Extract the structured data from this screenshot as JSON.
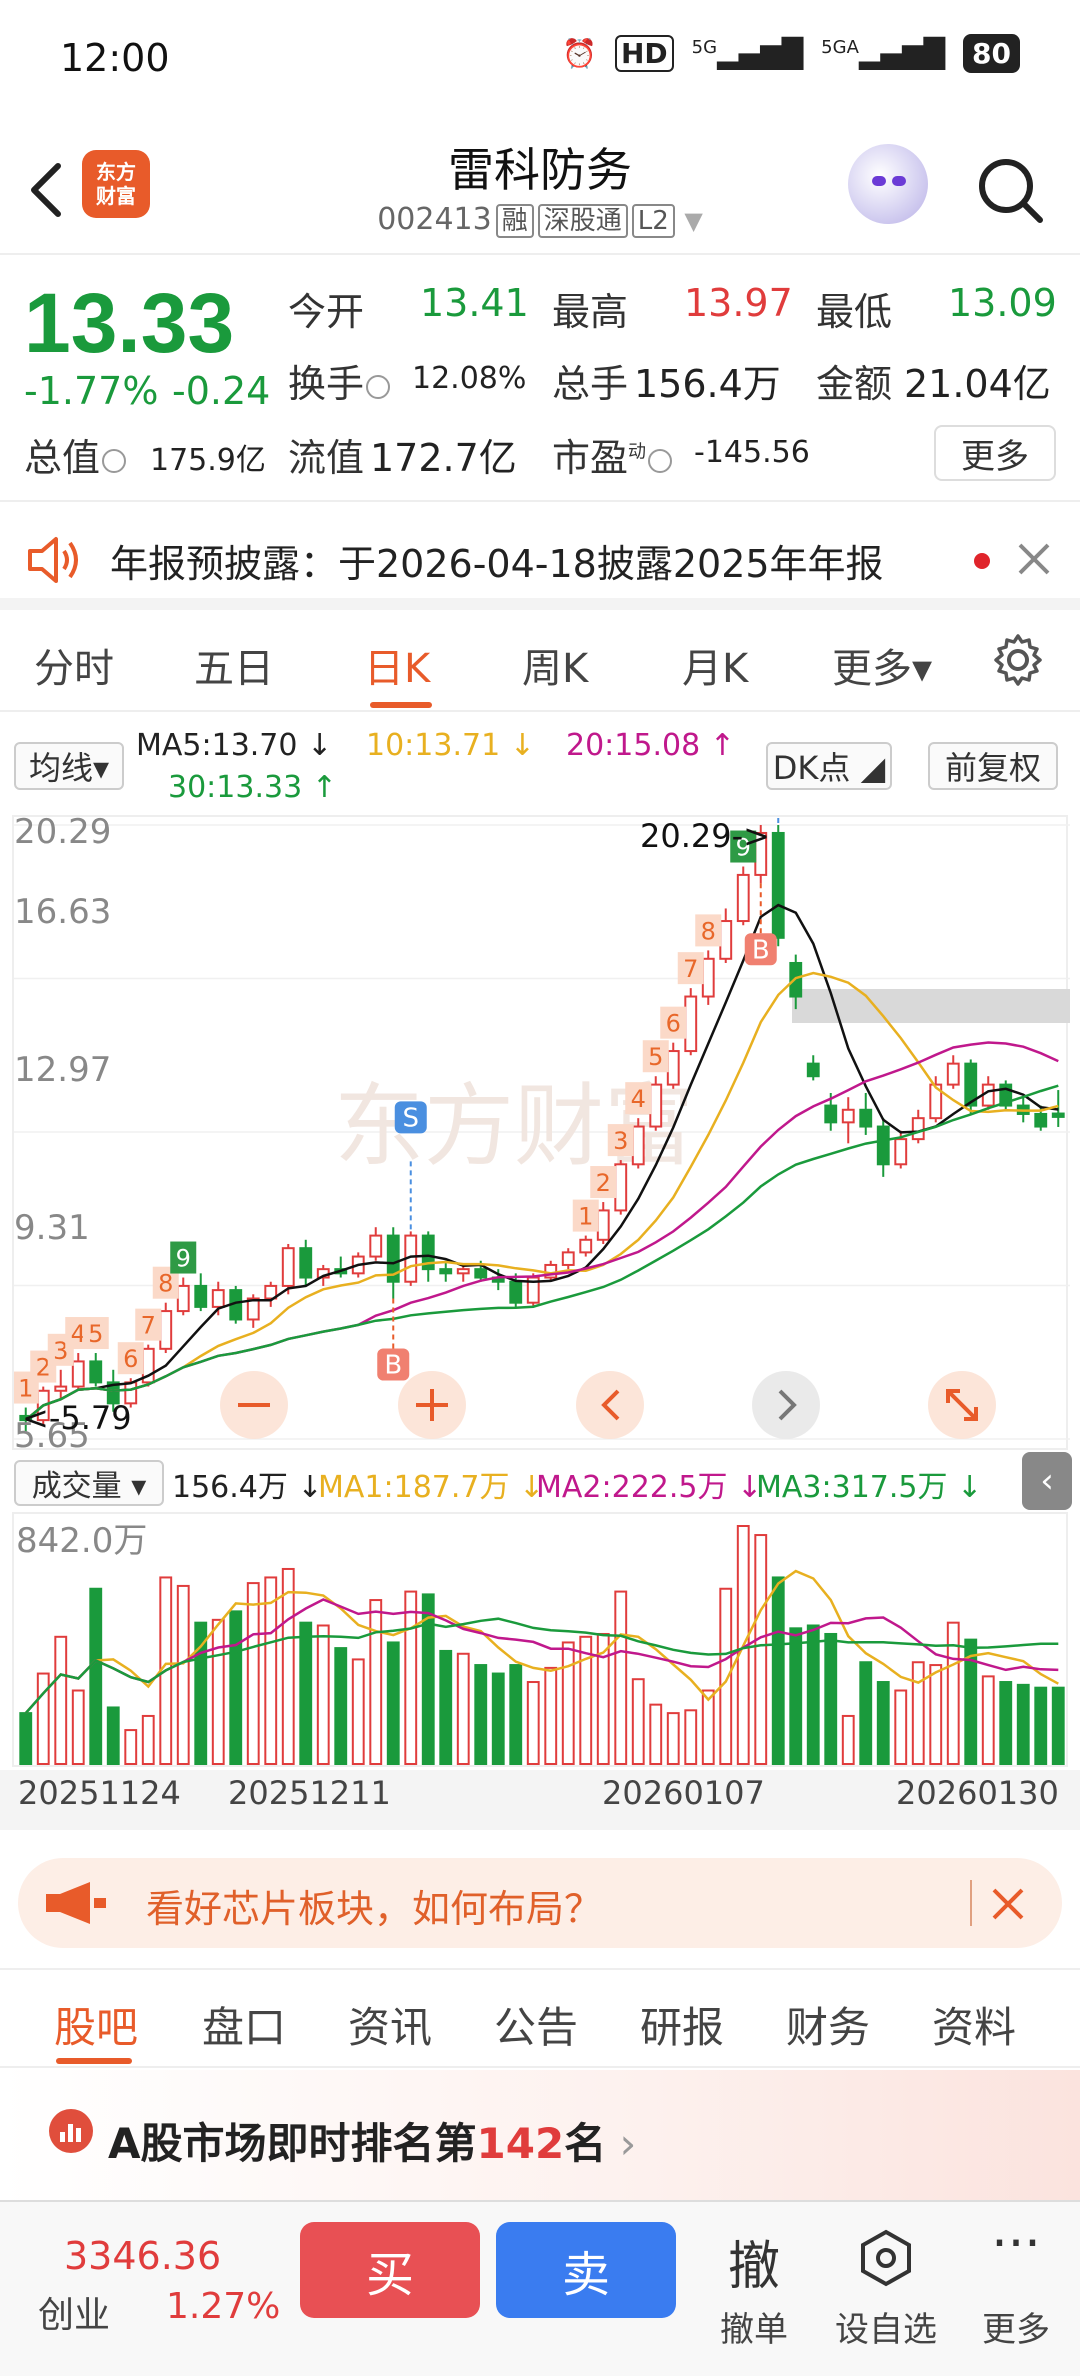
{
  "status": {
    "time": "12:00",
    "hd": "HD",
    "net1": "5G",
    "net2": "5GA",
    "battery": "80"
  },
  "header": {
    "name": "雷科防务",
    "code": "002413",
    "tags": [
      "融",
      "深股通",
      "L2"
    ],
    "logo_line1": "东方",
    "logo_line2": "财富"
  },
  "quote": {
    "price": "13.33",
    "change_pct": "-1.77%",
    "change": "-0.24",
    "open_label": "今开",
    "open": "13.41",
    "high_label": "最高",
    "high": "13.97",
    "low_label": "最低",
    "low": "13.09",
    "turnover_label": "换手",
    "turnover": "12.08%",
    "volume_label": "总手",
    "volume": "156.4万",
    "amount_label": "金额",
    "amount": "21.04亿",
    "mktcap_label": "总值",
    "mktcap": "175.9亿",
    "float_label": "流值",
    "float": "172.7亿",
    "pe_label": "市盈",
    "pe_sup": "动",
    "pe": "-145.56",
    "more": "更多"
  },
  "notice": {
    "text": "年报预披露：于2026-04-18披露2025年年报"
  },
  "ktabs": [
    "分时",
    "五日",
    "日K",
    "周K",
    "月K",
    "更多▾"
  ],
  "ma": {
    "select": "均线▾",
    "ma5": "MA5:13.70 ↓",
    "ma10": "10:13.71 ↓",
    "ma20": "20:15.08 ↑",
    "ma30": "30:13.33 ↑",
    "dk": "DK点 ◢",
    "adjust": "前复权"
  },
  "kline": {
    "ymax": "20.29",
    "y2": "16.63",
    "y3": "12.97",
    "y4": "9.31",
    "ymin": "5.65",
    "peak_label": "20.29->",
    "low_label": "<-5.79",
    "seq_labels": [
      "1",
      "2",
      "3",
      "4",
      "5",
      "6",
      "7",
      "8",
      "9",
      "1",
      "2",
      "3",
      "4",
      "5",
      "6",
      "7",
      "8",
      "9"
    ],
    "signal_s": "S",
    "signal_b": "B",
    "watermark": "东方财富"
  },
  "volume": {
    "select": "成交量 ▾",
    "vol": "156.4万 ↓",
    "ma1": "MA1:187.7万 ↓",
    "ma2": "MA2:222.5万 ↓",
    "ma3": "MA3:317.5万 ↓",
    "max": "842.0万"
  },
  "dates": [
    "20251124",
    "20251211",
    "20260107",
    "20260130"
  ],
  "promo": {
    "text": "看好芯片板块，如何布局？"
  },
  "btabs": [
    "股吧",
    "盘口",
    "资讯",
    "公告",
    "研报",
    "财务",
    "资料"
  ],
  "rank": {
    "prefix": "A股市场即时排名第",
    "num": "142",
    "suffix": "名"
  },
  "bottom": {
    "index": "3346.36",
    "index_name": "创业",
    "index_pct": "1.27%",
    "buy": "买",
    "sell": "卖",
    "cancel_glyph": "撤",
    "cancel": "撤单",
    "watch": "设自选",
    "more": "更多"
  },
  "colors": {
    "up": "#e03c3c",
    "down": "#1a9a3c",
    "accent": "#e85b2a"
  },
  "chart_data": {
    "type": "candlestick",
    "ylim": [
      5.65,
      20.29
    ],
    "y_ticks": [
      20.29,
      16.63,
      12.97,
      9.31,
      5.65
    ],
    "x_ticks": [
      "20251124",
      "20251211",
      "20260107",
      "20260130"
    ],
    "candles": [
      [
        6.2,
        6.4,
        5.8,
        6.1
      ],
      [
        6.1,
        6.9,
        6.0,
        6.8
      ],
      [
        6.8,
        7.3,
        6.6,
        6.9
      ],
      [
        6.9,
        7.7,
        6.8,
        7.5
      ],
      [
        7.5,
        7.7,
        6.9,
        7.0
      ],
      [
        7.0,
        7.3,
        6.3,
        6.5
      ],
      [
        6.5,
        7.1,
        6.4,
        7.0
      ],
      [
        7.0,
        7.9,
        6.9,
        7.8
      ],
      [
        7.8,
        8.9,
        7.7,
        8.7
      ],
      [
        8.7,
        9.5,
        8.6,
        9.3
      ],
      [
        9.3,
        9.6,
        8.7,
        8.8
      ],
      [
        8.8,
        9.4,
        8.6,
        9.2
      ],
      [
        9.2,
        9.3,
        8.4,
        8.5
      ],
      [
        8.5,
        9.1,
        8.3,
        9.0
      ],
      [
        9.0,
        9.4,
        8.8,
        9.3
      ],
      [
        9.3,
        10.3,
        9.1,
        10.2
      ],
      [
        10.2,
        10.4,
        9.3,
        9.5
      ],
      [
        9.5,
        9.8,
        9.3,
        9.7
      ],
      [
        9.7,
        10.0,
        9.5,
        9.6
      ],
      [
        9.6,
        10.1,
        9.5,
        10.0
      ],
      [
        10.0,
        10.7,
        9.9,
        10.5
      ],
      [
        10.5,
        10.7,
        9.0,
        9.4
      ],
      [
        9.4,
        10.6,
        9.3,
        10.5
      ],
      [
        10.5,
        10.6,
        9.4,
        9.7
      ],
      [
        9.7,
        9.9,
        9.4,
        9.6
      ],
      [
        9.6,
        9.8,
        9.4,
        9.7
      ],
      [
        9.7,
        9.9,
        9.4,
        9.5
      ],
      [
        9.5,
        9.7,
        9.2,
        9.4
      ],
      [
        9.4,
        9.6,
        8.8,
        8.9
      ],
      [
        8.9,
        9.6,
        8.8,
        9.5
      ],
      [
        9.5,
        9.9,
        9.4,
        9.8
      ],
      [
        9.8,
        10.2,
        9.7,
        10.1
      ],
      [
        10.1,
        10.5,
        10.0,
        10.4
      ],
      [
        10.4,
        11.3,
        10.3,
        11.1
      ],
      [
        11.1,
        12.3,
        11.0,
        12.2
      ],
      [
        12.2,
        13.3,
        12.1,
        13.1
      ],
      [
        13.1,
        14.3,
        13.0,
        14.1
      ],
      [
        14.1,
        15.1,
        14.0,
        14.9
      ],
      [
        14.9,
        16.4,
        14.8,
        16.2
      ],
      [
        16.2,
        17.3,
        16.0,
        17.1
      ],
      [
        17.1,
        18.3,
        17.0,
        18.0
      ],
      [
        18.0,
        19.3,
        17.9,
        19.1
      ],
      [
        19.1,
        20.29,
        18.9,
        20.1
      ],
      [
        20.1,
        20.29,
        17.4,
        17.6
      ],
      [
        17.0,
        17.2,
        15.9,
        16.2
      ],
      [
        14.6,
        14.8,
        14.2,
        14.3
      ],
      [
        13.6,
        13.9,
        13.0,
        13.2
      ],
      [
        13.2,
        13.8,
        12.7,
        13.5
      ],
      [
        13.5,
        13.9,
        12.9,
        13.1
      ],
      [
        13.1,
        13.3,
        11.9,
        12.2
      ],
      [
        12.2,
        13.0,
        12.1,
        12.8
      ],
      [
        12.8,
        13.5,
        12.7,
        13.3
      ],
      [
        13.3,
        14.3,
        13.2,
        14.1
      ],
      [
        14.1,
        14.8,
        14.0,
        14.6
      ],
      [
        14.6,
        14.7,
        13.4,
        13.6
      ],
      [
        13.6,
        14.3,
        13.5,
        14.1
      ],
      [
        14.1,
        14.2,
        13.5,
        13.6
      ],
      [
        13.6,
        13.8,
        13.2,
        13.4
      ],
      [
        13.4,
        13.6,
        13.0,
        13.1
      ],
      [
        13.41,
        13.97,
        13.09,
        13.33
      ]
    ],
    "volume": [
      1.8,
      3.2,
      4.5,
      2.6,
      6.2,
      2.0,
      1.2,
      1.7,
      6.6,
      6.3,
      5.0,
      5.1,
      5.4,
      6.4,
      6.6,
      6.9,
      5.0,
      4.9,
      4.1,
      3.7,
      5.8,
      4.3,
      6.1,
      6.0,
      4.0,
      3.9,
      3.5,
      3.2,
      3.5,
      2.9,
      3.4,
      4.3,
      4.5,
      4.6,
      6.1,
      3.0,
      2.1,
      1.8,
      1.9,
      2.6,
      6.2,
      8.42,
      8.1,
      6.6,
      4.8,
      4.9,
      4.6,
      1.7,
      3.6,
      2.9,
      2.6,
      3.6,
      3.5,
      5.0,
      4.4,
      3.1,
      2.9,
      2.8,
      2.7,
      2.7
    ]
  }
}
